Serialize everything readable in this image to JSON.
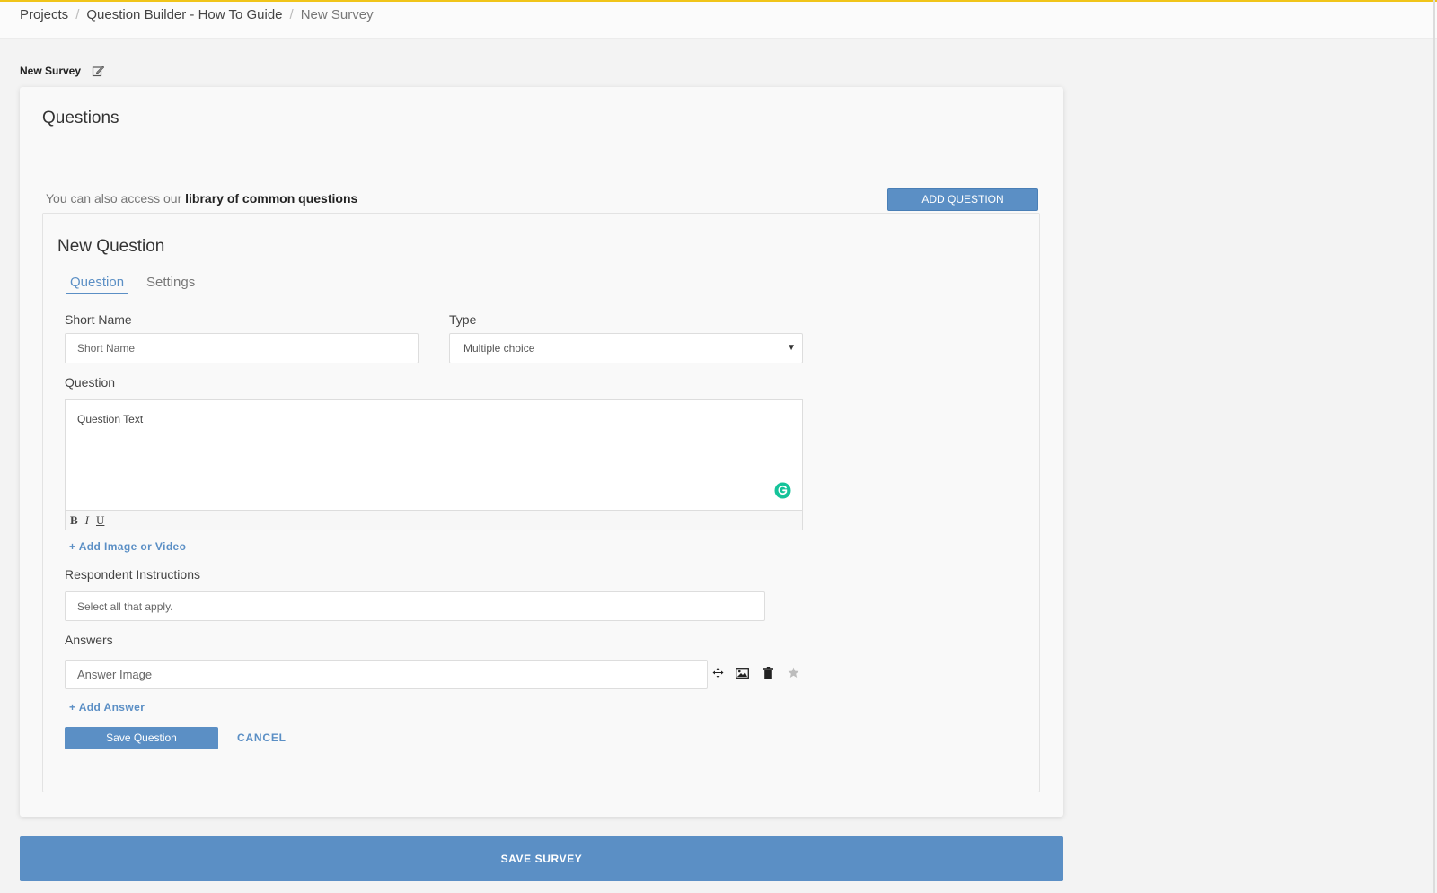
{
  "breadcrumb": {
    "items": [
      "Projects",
      "Question Builder - How To Guide",
      "New Survey"
    ],
    "separator": "/"
  },
  "survey": {
    "title": "New Survey",
    "edit_icon": "edit-icon"
  },
  "questions_card": {
    "title": "Questions",
    "library_prefix": "You can also access our ",
    "library_link": "library of common questions",
    "add_question_label": "ADD QUESTION"
  },
  "new_question": {
    "title": "New Question",
    "tabs": [
      {
        "label": "Question",
        "active": true
      },
      {
        "label": "Settings",
        "active": false
      }
    ],
    "short_name": {
      "label": "Short Name",
      "placeholder": "Short Name",
      "value": ""
    },
    "type": {
      "label": "Type",
      "value": "Multiple choice"
    },
    "question": {
      "label": "Question",
      "placeholder": "Question Text",
      "toolbar": {
        "bold": "B",
        "italic": "I",
        "underline": "U"
      }
    },
    "add_media_label": "+ Add Image or Video",
    "respondent_instructions": {
      "label": "Respondent Instructions",
      "placeholder": "Select all that apply."
    },
    "answers": {
      "label": "Answers",
      "items": [
        {
          "placeholder": "Answer Image"
        }
      ],
      "icons": [
        "move-icon",
        "image-icon",
        "trash-icon",
        "star-icon"
      ]
    },
    "add_answer_label": "+ Add Answer",
    "save_label": "Save Question",
    "cancel_label": "CANCEL"
  },
  "save_survey_label": "SAVE SURVEY",
  "colors": {
    "accent": "#5b8fc5",
    "top_border": "#f0c419",
    "grammarly": "#15c39a"
  }
}
